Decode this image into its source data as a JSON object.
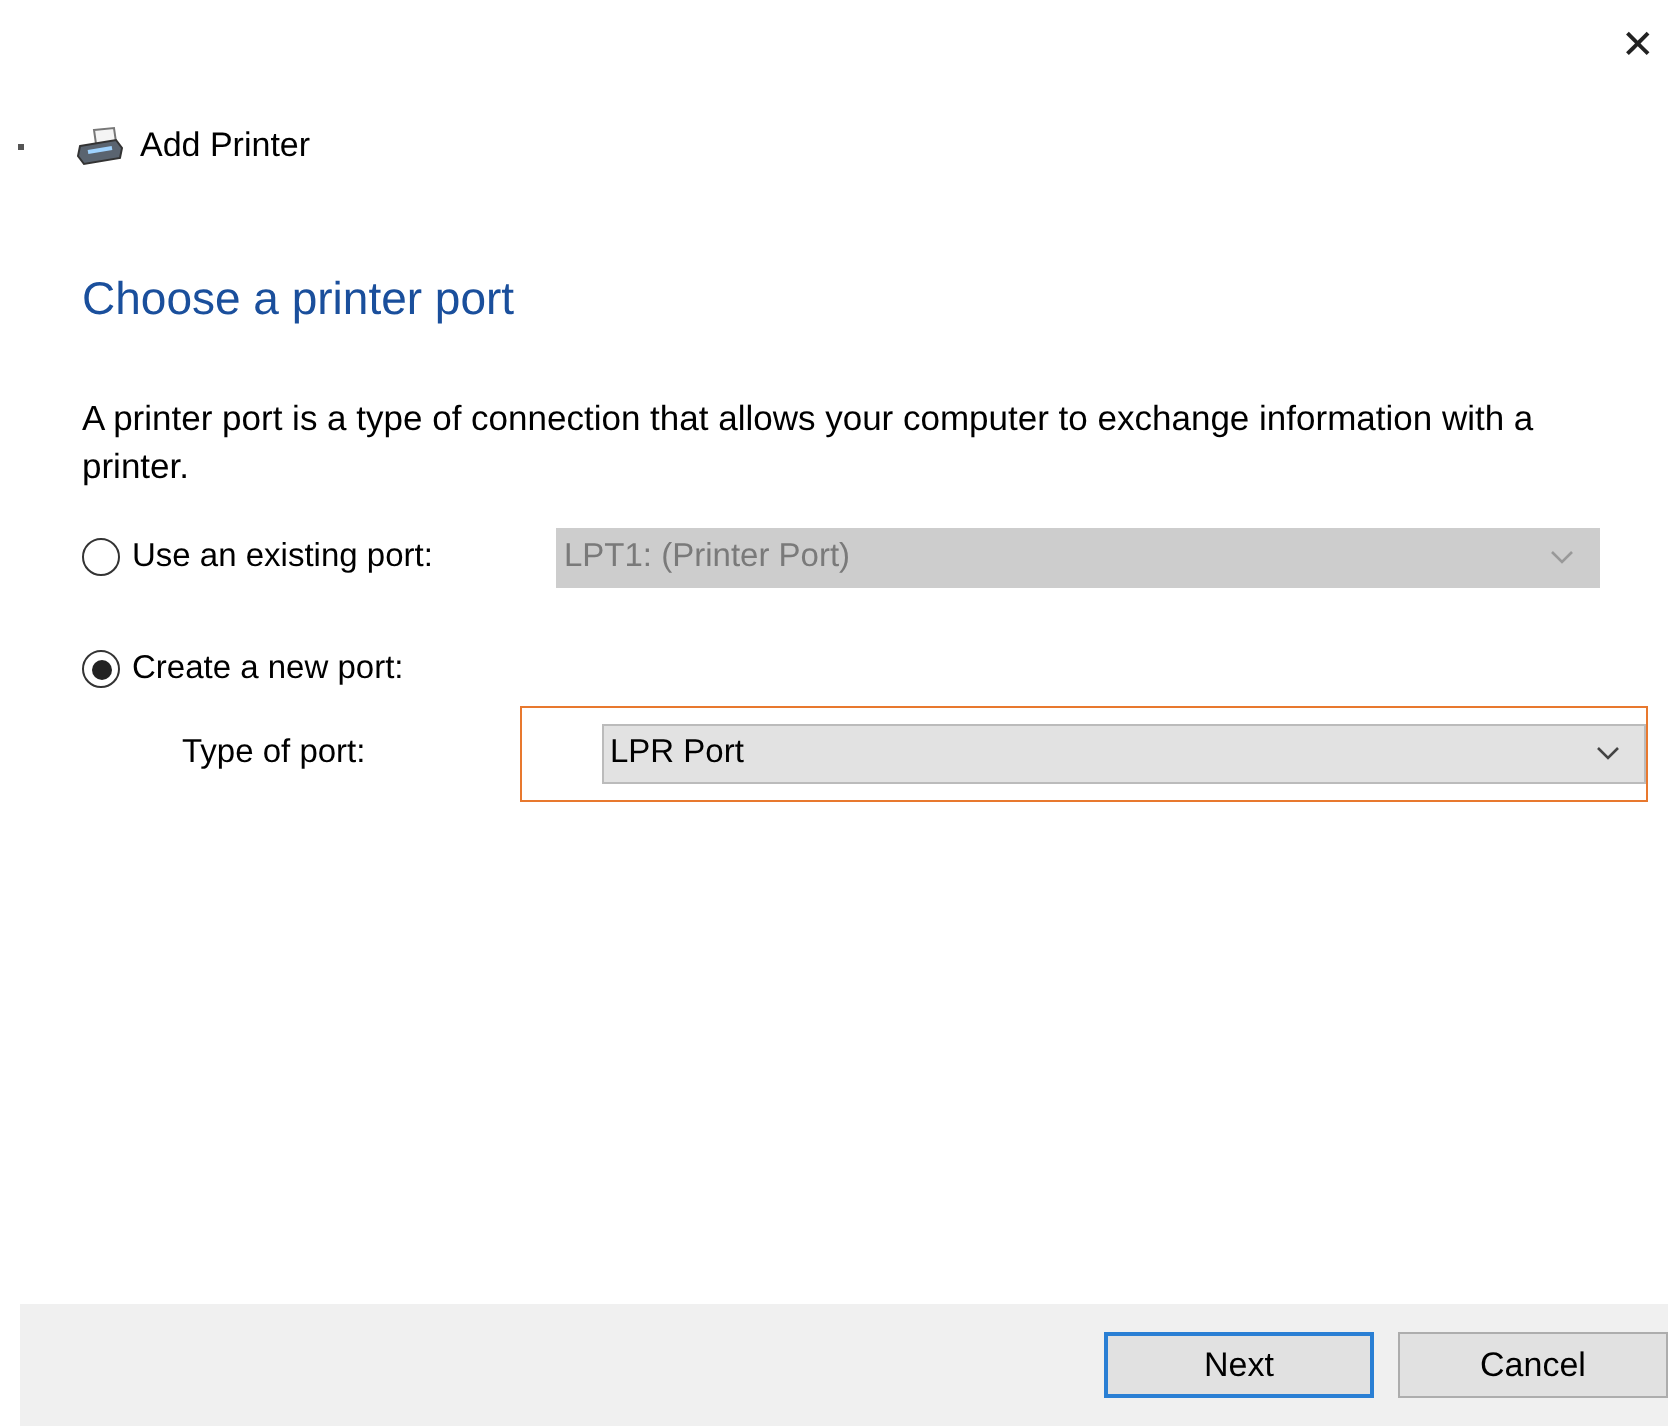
{
  "window": {
    "close_glyph": "✕"
  },
  "header": {
    "title": "Add Printer"
  },
  "heading": "Choose a printer port",
  "description": "A printer port is a type of connection that allows your computer to exchange information with a printer.",
  "options": [
    {
      "label": "Use an existing port:",
      "selected": false,
      "dropdown": {
        "value": "LPT1: (Printer Port)",
        "disabled": true,
        "highlighted": false
      }
    },
    {
      "label": "Create a new port:",
      "selected": true
    }
  ],
  "type_of_port": {
    "label": "Type of port:",
    "dropdown": {
      "value": "LPR Port",
      "disabled": false,
      "highlighted": true
    }
  },
  "buttons": [
    {
      "label": "Next",
      "default": true
    },
    {
      "label": "Cancel",
      "default": false
    }
  ]
}
